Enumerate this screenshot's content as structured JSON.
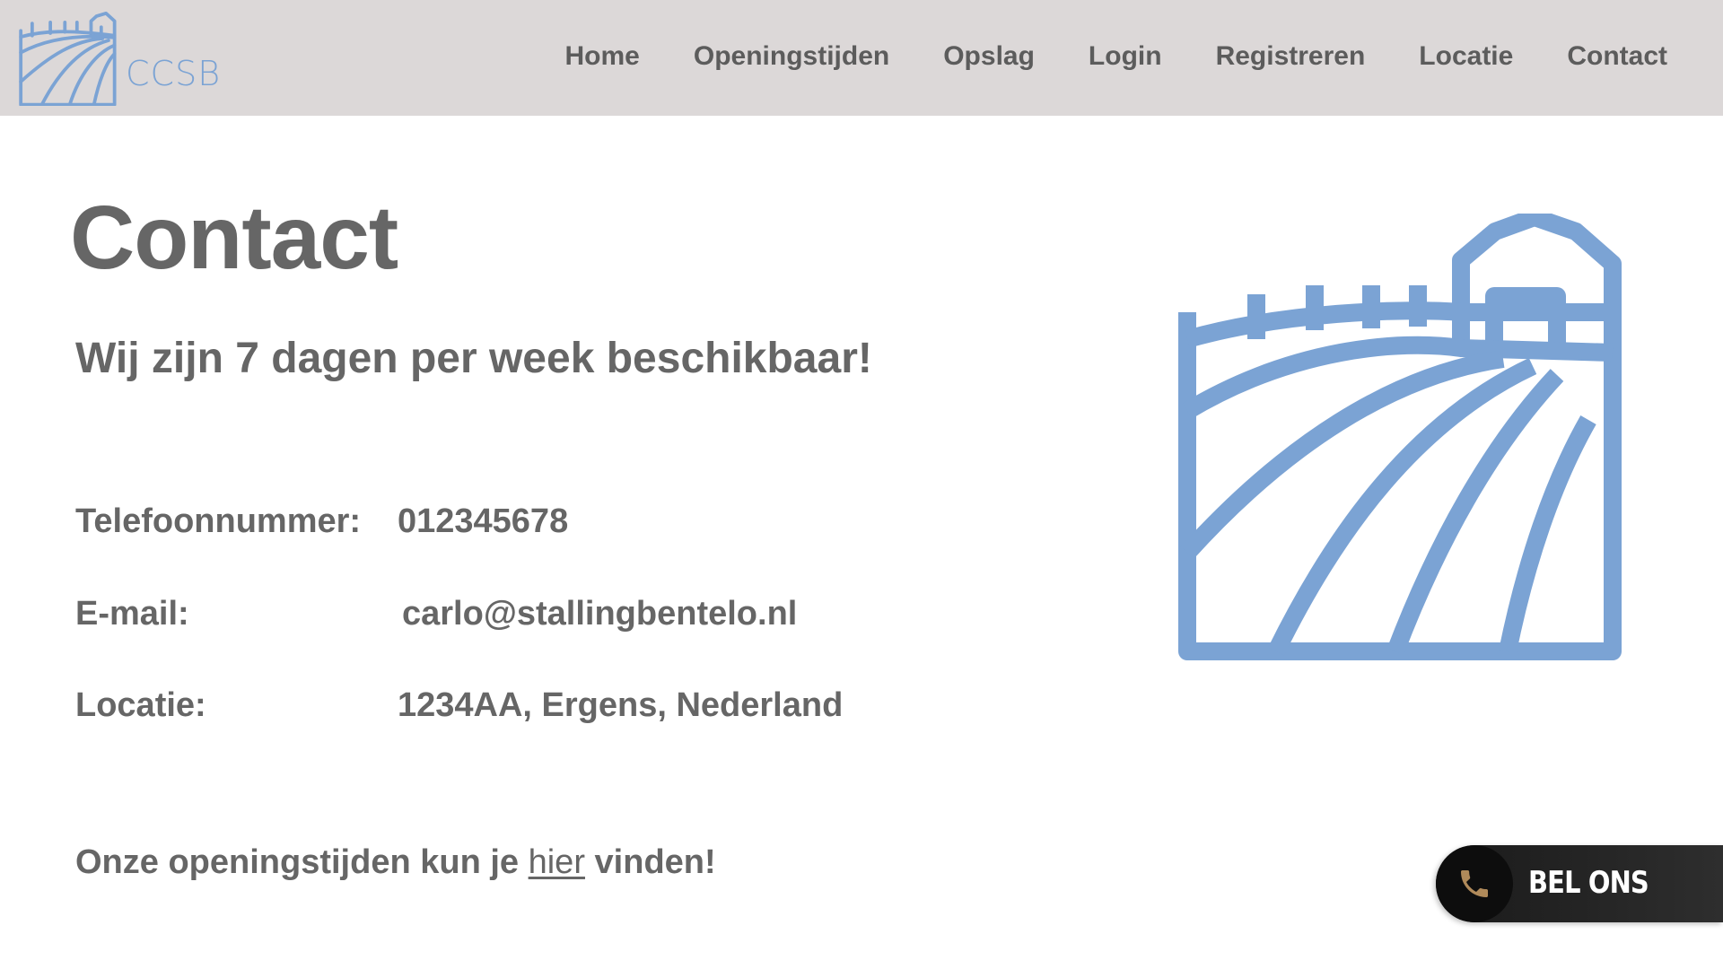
{
  "brand": {
    "name": "CCSB",
    "color": "#7ba3d4"
  },
  "nav": {
    "items": [
      {
        "label": "Home"
      },
      {
        "label": "Openingstijden"
      },
      {
        "label": "Opslag"
      },
      {
        "label": "Login"
      },
      {
        "label": "Registreren"
      },
      {
        "label": "Locatie"
      },
      {
        "label": "Contact"
      }
    ]
  },
  "main": {
    "title": "Contact",
    "subtitle": "Wij zijn 7 dagen per week beschikbaar!",
    "info": [
      {
        "label": "Telefoonnummer:",
        "value": "012345678"
      },
      {
        "label": "E-mail:",
        "value": "carlo@stallingbentelo.nl"
      },
      {
        "label": "Locatie:",
        "value": "1234AA, Ergens, Nederland"
      }
    ],
    "footer": {
      "before": "Onze openingstijden kun je ",
      "link": "hier",
      "after": " vinden!"
    }
  },
  "call_button": {
    "label": "BEL ONS",
    "icon": "phone-icon",
    "icon_color": "#b08a5a"
  },
  "illustration": {
    "icon": "farm-field-icon",
    "color": "#7ba3d4"
  }
}
